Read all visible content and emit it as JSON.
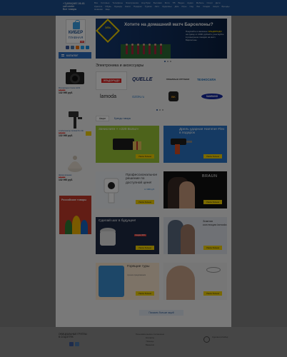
{
  "topbar": {
    "phone_lines": [
      "+7(4954)987-06-81",
      "call center",
      "Все товары"
    ],
    "nav": [
      "Все",
      "Сотовые",
      "Телефоны",
      "Электроника",
      "Ноутбуки",
      "Бытовая",
      "Фото",
      "ТВ",
      "Видео",
      "Аудио",
      "Мебель",
      "Спорт",
      "Дети",
      "Красота",
      "Обувь",
      "Одежда",
      "Книги",
      "Подарки",
      "Туризм",
      "Авто",
      "Здоровье",
      "Дом",
      "Игры",
      "Сад",
      "Зоо",
      "Скидки",
      "Акции",
      "Бренды",
      "Новинки",
      "Еще"
    ]
  },
  "logo": {
    "line1": "КИБЕР",
    "line2": "ГЛАВНАЯ",
    "tag": "new"
  },
  "sidebar": {
    "catalog_label": "КАТАЛОГ",
    "products": [
      {
        "name": "Фотоаппарат Canon EOS",
        "old_price": "135 990",
        "price": "132 990",
        "currency": "руб."
      },
      {
        "name": "Стабилизатор Gimbal Pro 3D",
        "old_price": "135 990",
        "price": "132 990",
        "currency": "руб."
      },
      {
        "name": "Шапка вязаная",
        "old_price": "135 990",
        "price": "132 990",
        "currency": "руб."
      }
    ],
    "promo_text": "Российские товары"
  },
  "hero": {
    "title": "Хотите на домашний матч Барселоны?",
    "badge": "ЭЛЬ",
    "desc_prefix": "Покупайте в магазине ",
    "desc_brand": "ЭЛЬДОРАДО",
    "desc_suffix": " на сумму от 2000 рублей и участвуйте в розыгрыше поездки на матч Барселоны"
  },
  "brands": {
    "section_title": "Электроника и аксессуары",
    "items": [
      "ЭЛЬДОРАДО",
      "QUELLE",
      "ЛЮБИМЫЕ ИГРУШКИ",
      "ТЕХНОСИЛА",
      "lamoda",
      "OZON.ru",
      "BK",
      "SAMSUNG"
    ]
  },
  "tabs": [
    "Акции",
    "Бренды товары"
  ],
  "cards": [
    {
      "title": "Зачислите + «220 Вольт»",
      "sub": "до 31 декабря",
      "button": "Узнать больше"
    },
    {
      "title": "Дрель ударная Hammer Flex в подарок",
      "sub": "при покупке",
      "button": "Узнать больше"
    },
    {
      "title": "Профессиональное решение по доступной цене!",
      "sub": "от 1990 руб.",
      "button": "Узнать больше"
    },
    {
      "title": "BRAUN",
      "sub": "",
      "button": "Узнать больше"
    },
    {
      "title": "Сделай шаг в будущее!",
      "sub": "Скидка 30%",
      "button": "Узнать больше"
    },
    {
      "title": "Зимняя коллекция lamoda",
      "sub": "",
      "button": "Узнать больше"
    },
    {
      "title": "Горящие туры",
      "sub": "лучшие предложения",
      "button": "Узнать больше"
    },
    {
      "title": "",
      "sub": "",
      "button": "Узнать больше"
    }
  ],
  "more_button": "Показать больше акций",
  "footer": {
    "social_title": "ОФИЦИАЛЬНЫЕ ГРУППЫ В СОЦСЕТЯХ",
    "links": [
      "Пользовательское соглашение",
      "Контакты",
      "Помощь",
      "Вакансии"
    ],
    "brand": "Сделано в Кибер"
  },
  "colors": {
    "topbar": "#1d4f8e",
    "accent": "#2a6cbf",
    "button_yellow": "#f5d300",
    "sale_red": "#e53935"
  }
}
